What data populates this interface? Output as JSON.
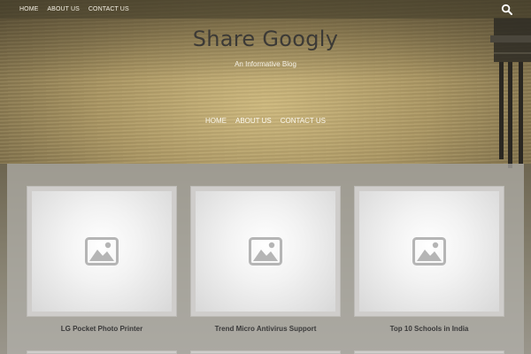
{
  "topbar": {
    "nav": [
      "HOME",
      "ABOUT US",
      "CONTACT US"
    ],
    "search_icon": "search-icon"
  },
  "site": {
    "title": "Share Googly",
    "tagline": "An Informative Blog"
  },
  "main_nav": [
    "HOME",
    "ABOUT US",
    "CONTACT US"
  ],
  "posts": [
    {
      "title": "LG Pocket Photo Printer",
      "thumbnail_icon": "image-placeholder-icon"
    },
    {
      "title": "Trend Micro Antivirus Support",
      "thumbnail_icon": "image-placeholder-icon"
    },
    {
      "title": "Top 10 Schools in India",
      "thumbnail_icon": "image-placeholder-icon"
    }
  ]
}
